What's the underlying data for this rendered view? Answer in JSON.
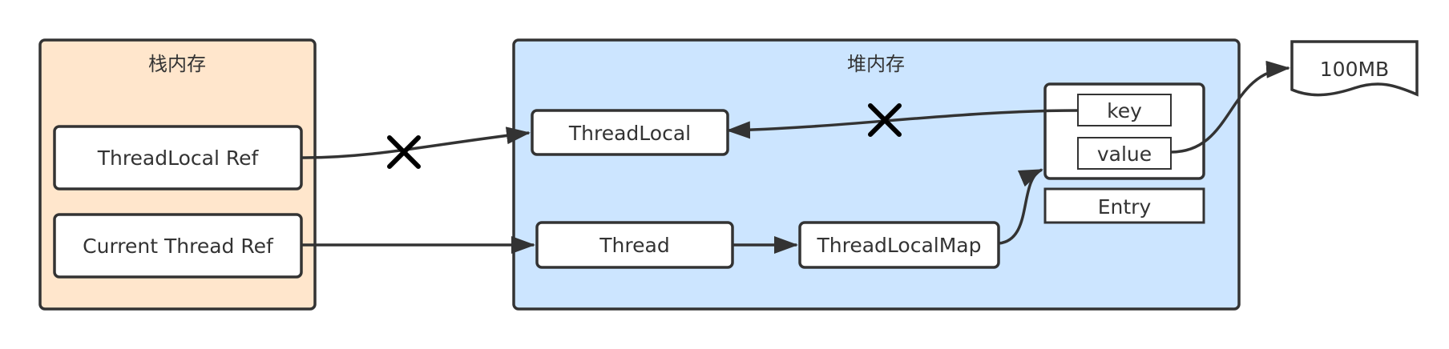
{
  "regions": {
    "stack": {
      "title": "栈内存",
      "fill": "#FFE6CC"
    },
    "heap": {
      "title": "堆内存",
      "fill": "#CCE5FF"
    }
  },
  "nodes": {
    "threadlocal_ref": "ThreadLocal Ref",
    "current_thread_ref": "Current Thread Ref",
    "threadlocal": "ThreadLocal",
    "thread": "Thread",
    "threadlocalmap": "ThreadLocalMap",
    "entry_key": "key",
    "entry_value": "value",
    "entry_label": "Entry",
    "memory_doc": "100MB"
  },
  "colors": {
    "entry_fill": "#FFCCCC",
    "stroke": "#333333"
  },
  "edges": [
    {
      "from": "ThreadLocal Ref",
      "to": "ThreadLocal",
      "broken": true
    },
    {
      "from": "key",
      "to": "ThreadLocal",
      "broken": true
    },
    {
      "from": "Current Thread Ref",
      "to": "Thread",
      "broken": false
    },
    {
      "from": "Thread",
      "to": "ThreadLocalMap",
      "broken": false
    },
    {
      "from": "ThreadLocalMap",
      "to": "Entry",
      "broken": false
    },
    {
      "from": "value",
      "to": "100MB",
      "broken": false
    }
  ]
}
